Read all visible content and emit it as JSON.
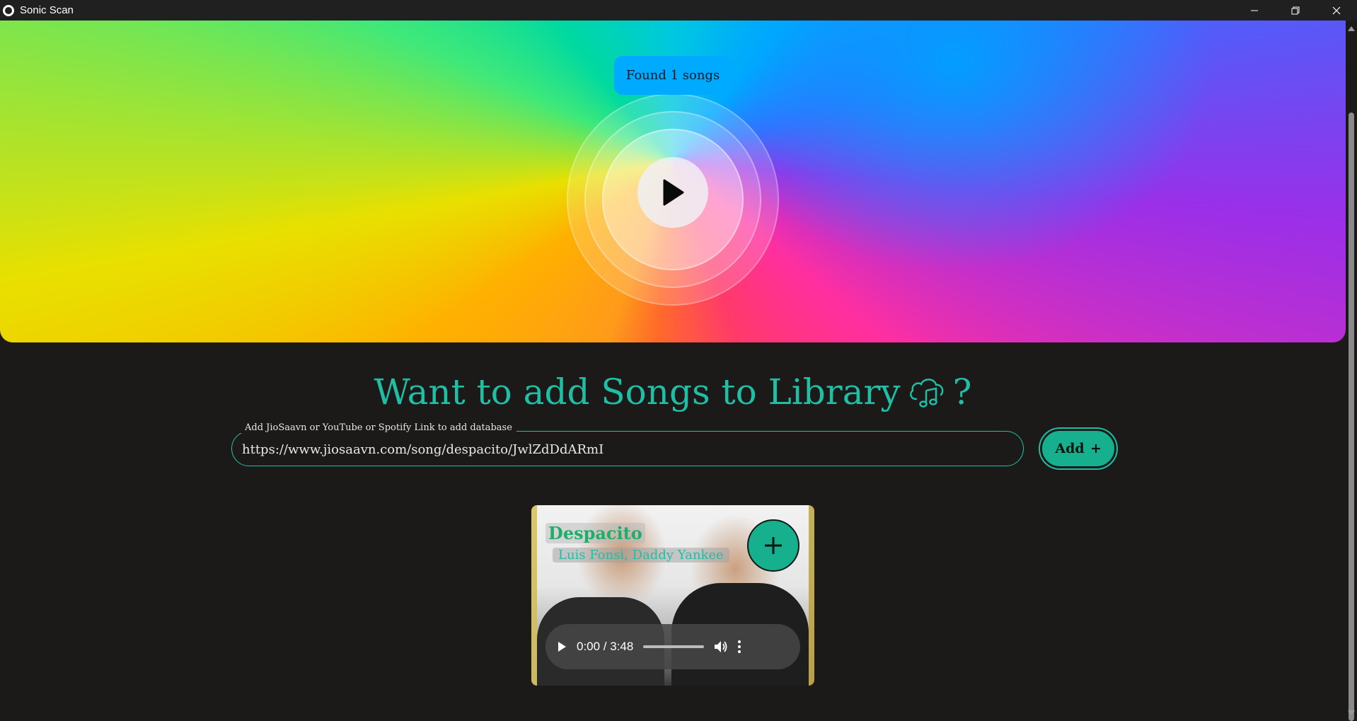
{
  "window": {
    "title": "Sonic Scan",
    "controls": [
      "minimize",
      "restore",
      "close"
    ]
  },
  "hero": {
    "status_badge": "Found 1 songs",
    "play_icon": "play-icon"
  },
  "library": {
    "heading": "Want to add Songs to Library",
    "heading_icon": "cloud-music-icon",
    "heading_suffix": "?",
    "input_label": "Add JioSaavn or YouTube or Spotify Link to add database",
    "input_value": "https://www.jiosaavn.com/song/despacito/JwlZdDdARmI",
    "add_button_label": "Add",
    "add_button_icon": "plus-icon"
  },
  "song_card": {
    "title": "Despacito",
    "artists": "Luis Fonsi, Daddy Yankee",
    "add_icon": "plus-icon",
    "player": {
      "time": "0:00 / 3:48"
    }
  },
  "colors": {
    "accent": "#1ebfa5",
    "button": "#17b08e",
    "badge": "#00aaff",
    "background": "#1c1a19"
  }
}
